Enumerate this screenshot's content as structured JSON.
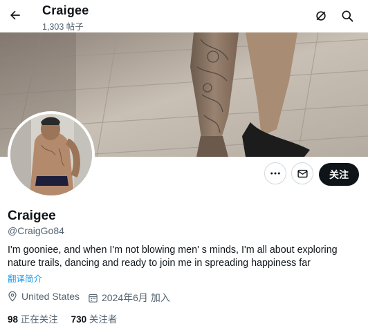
{
  "header": {
    "title": "Craigee",
    "subtitle": "1,303 帖子"
  },
  "icons": {
    "back": "arrow-left-icon",
    "grok": "slashed-circle-icon",
    "search": "search-icon",
    "more": "more-dots-icon",
    "message": "envelope-icon",
    "location": "location-pin-icon",
    "calendar": "calendar-icon"
  },
  "actions": {
    "follow_label": "关注"
  },
  "profile": {
    "name": "Craigee",
    "handle": "@CraigGo84",
    "bio": "I'm gooniee, and when I'm not blowing men' s minds, I'm all about exploring nature trails, dancing and ready to join me in spreading happiness far",
    "translate_label": "翻译简介",
    "location": "United States",
    "joined": "2024年6月 加入"
  },
  "stats": {
    "following_count": "98",
    "following_label": "正在关注",
    "followers_count": "730",
    "followers_label": "关注者"
  },
  "colors": {
    "accent": "#1d9bf0",
    "text_primary": "#0f1419",
    "text_secondary": "#536471",
    "follow_bg": "#0f1419"
  }
}
